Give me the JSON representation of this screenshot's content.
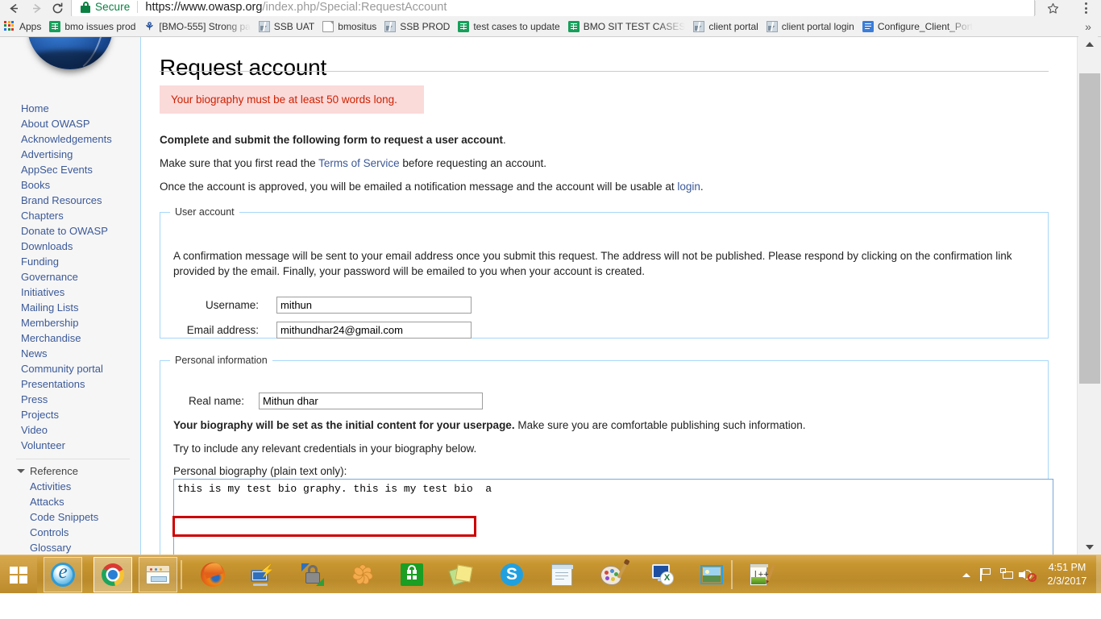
{
  "browser": {
    "security_label": "Secure",
    "url_host": "https://www.owasp.org",
    "url_path": "/index.php/Special:RequestAccount",
    "nav": {
      "back": "Back",
      "forward": "Forward",
      "reload": "Reload",
      "star": "Bookmark this page",
      "menu": "Customize and control Google Chrome"
    },
    "bookmarks": [
      {
        "label": "Apps",
        "icon": "apps-grid-icon"
      },
      {
        "label": "bmo issues prod",
        "icon": "sheet-icon"
      },
      {
        "label": "[BMO-555] Strong pa",
        "icon": "jira-icon"
      },
      {
        "label": "SSB UAT",
        "icon": "broken-image-icon"
      },
      {
        "label": "bmositus",
        "icon": "page-icon"
      },
      {
        "label": "SSB PROD",
        "icon": "broken-image-icon"
      },
      {
        "label": "test cases to update",
        "icon": "sheet-icon"
      },
      {
        "label": "BMO SIT TEST CASES",
        "icon": "sheet-icon"
      },
      {
        "label": "client portal",
        "icon": "broken-image-icon"
      },
      {
        "label": "client portal login",
        "icon": "broken-image-icon"
      },
      {
        "label": "Configure_Client_Port",
        "icon": "blue-doc-icon"
      }
    ],
    "bookmarks_overflow": "»"
  },
  "sidebar": {
    "logo_alt": "OWASP logo",
    "items": [
      "Home",
      "About OWASP",
      "Acknowledgements",
      "Advertising",
      "AppSec Events",
      "Books",
      "Brand Resources",
      "Chapters",
      "Donate to OWASP",
      "Downloads",
      "Funding",
      "Governance",
      "Initiatives",
      "Mailing Lists",
      "Membership",
      "Merchandise",
      "News",
      "Community portal",
      "Presentations",
      "Press",
      "Projects",
      "Video",
      "Volunteer"
    ],
    "reference": {
      "label": "Reference",
      "expanded": true,
      "items": [
        "Activities",
        "Attacks",
        "Code Snippets",
        "Controls",
        "Glossary"
      ]
    }
  },
  "page": {
    "title": "Request account",
    "error_message": "Your biography must be at least 50 words long.",
    "intro_bold": "Complete and submit the following form to request a user account",
    "intro_bold_tail": ".",
    "tos_prefix": "Make sure that you first read the ",
    "tos_link": "Terms of Service",
    "tos_suffix": " before requesting an account.",
    "approved_prefix": "Once the account is approved, you will be emailed a notification message and the account will be usable at ",
    "approved_link": "login",
    "approved_suffix": "."
  },
  "user_account": {
    "legend": "User account",
    "note": "A confirmation message will be sent to your email address once you submit this request. The address will not be published. Please respond by clicking on the confirmation link provided by the email. Finally, your password will be emailed to you when your account is created.",
    "username_label": "Username:",
    "username_value": "mithun",
    "email_label": "Email address:",
    "email_value": "mithundhar24@gmail.com"
  },
  "personal_information": {
    "legend": "Personal information",
    "realname_label": "Real name:",
    "realname_value": "Mithun dhar",
    "bio_bold": "Your biography will be set as the initial content for your userpage.",
    "bio_bold_tail": " Make sure you are comfortable publishing such information.",
    "bio_hint": "Try to include any relevant credentials in your biography below.",
    "bio_label": "Personal biography (plain text only):",
    "bio_value": "this is my test bio graphy. this is my test bio  a"
  },
  "scrollbar": {
    "up_arrow": "▲",
    "down_arrow": "▼"
  },
  "taskbar": {
    "start_label": "Start",
    "items": [
      {
        "name": "internet-explorer",
        "label": "Internet Explorer",
        "state": "pinned"
      },
      {
        "name": "google-chrome",
        "label": "Google Chrome",
        "state": "active"
      },
      {
        "name": "file-explorer",
        "label": "File Explorer",
        "state": "pinned"
      },
      {
        "name": "mozilla-firefox",
        "label": "Mozilla Firefox",
        "state": "open"
      },
      {
        "name": "remote-desktop",
        "label": "Remote Desktop Connection",
        "state": "open"
      },
      {
        "name": "secure-transfer",
        "label": "Secure Transfer",
        "state": "open"
      },
      {
        "name": "flower-app",
        "label": "Flower App",
        "state": "open"
      },
      {
        "name": "store",
        "label": "Store",
        "state": "open"
      },
      {
        "name": "sticky-notes",
        "label": "Sticky Notes",
        "state": "open"
      },
      {
        "name": "skype",
        "label": "Skype",
        "state": "open"
      },
      {
        "name": "notepad",
        "label": "Notepad",
        "state": "open"
      },
      {
        "name": "paint",
        "label": "Paint",
        "state": "open"
      },
      {
        "name": "excel-monitor",
        "label": "Excel Monitor",
        "state": "open"
      },
      {
        "name": "photo-viewer",
        "label": "Photo Viewer",
        "state": "open"
      },
      {
        "name": "notepad-plus-plus",
        "label": "Notepad++",
        "state": "open"
      }
    ],
    "tray": {
      "expand": "Show hidden icons",
      "action_center": "Action Center",
      "network": "Network",
      "volume": "Volume (muted)"
    },
    "clock_time": "4:51 PM",
    "clock_date": "2/3/2017"
  }
}
